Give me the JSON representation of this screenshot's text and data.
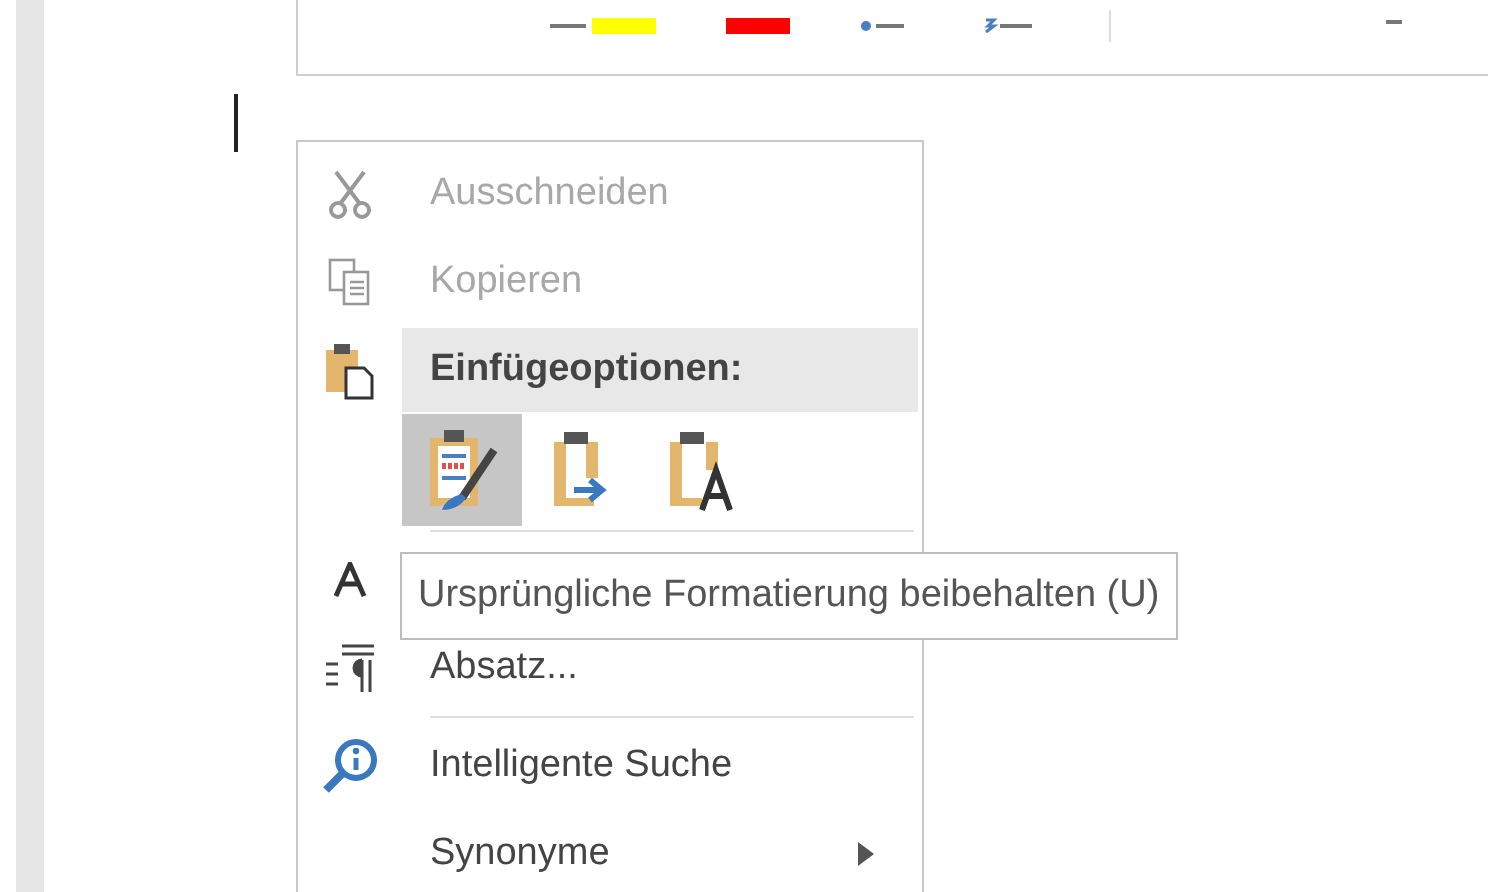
{
  "context_menu": {
    "items": [
      {
        "kind": "cut",
        "label": "Ausschneiden",
        "disabled": true
      },
      {
        "kind": "copy",
        "label": "Kopieren",
        "disabled": true
      },
      {
        "kind": "header",
        "label": "Einfügeoptionen:"
      },
      {
        "kind": "paste_options",
        "options": [
          {
            "selected": true
          },
          {
            "selected": false
          },
          {
            "selected": false
          }
        ]
      },
      {
        "kind": "separator"
      },
      {
        "kind": "font"
      },
      {
        "kind": "paragraph",
        "label": "Absatz...",
        "disabled": false
      },
      {
        "kind": "separator"
      },
      {
        "kind": "lookup",
        "label": "Intelligente Suche",
        "disabled": false
      },
      {
        "kind": "submenu",
        "label": "Synonyme"
      }
    ]
  },
  "tooltip": {
    "text": "Ursprüngliche Formatierung beibehalten (U)"
  }
}
